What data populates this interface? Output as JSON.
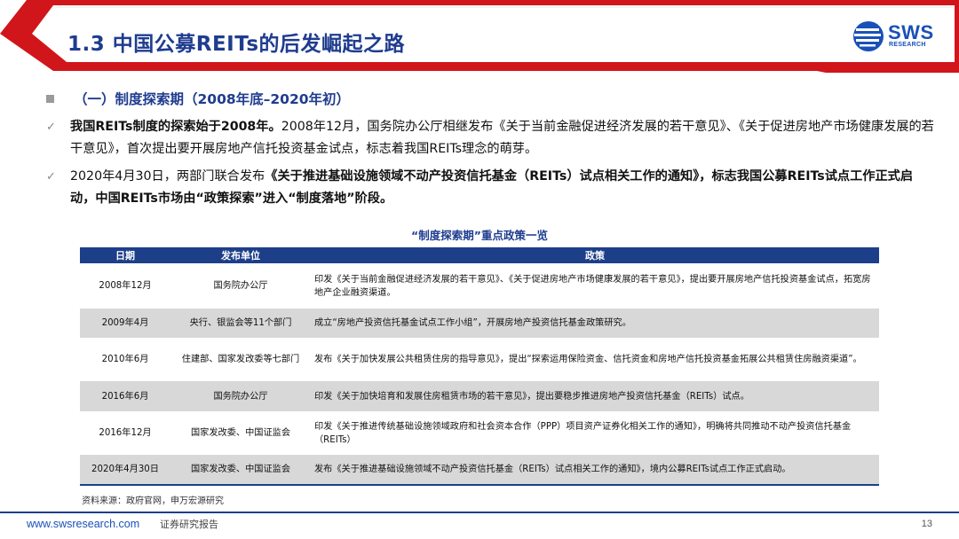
{
  "header": {
    "title": "1.3 中国公募REITs的后发崛起之路",
    "logo_text": "SWS",
    "logo_subtext": "RESEARCH"
  },
  "section": {
    "heading": "（一）制度探索期（2008年底–2020年初）"
  },
  "bullets": [
    {
      "bold": "我国REITs制度的探索始于2008年。",
      "text": "2008年12月，国务院办公厅相继发布《关于当前金融促进经济发展的若干意见》、《关于促进房地产市场健康发展的若干意见》，首次提出要开展房地产信托投资基金试点，标志着我国REITs理念的萌芽。"
    },
    {
      "text": "2020年4月30日，两部门联合发布",
      "bold": "《关于推进基础设施领域不动产投资信托基金（REITs）试点相关工作的通知》，标志我国公募REITs试点工作正式启动，中国REITs市场由“政策探索”进入“制度落地”阶段。"
    }
  ],
  "table": {
    "title": "“制度探索期”重点政策一览",
    "headers": [
      "日期",
      "发布单位",
      "政策"
    ],
    "rows": [
      {
        "date": "2008年12月",
        "issuer": "国务院办公厅",
        "policy": "印发《关于当前金融促进经济发展的若干意见》、《关于促进房地产市场健康发展的若干意见》，提出要开展房地产信托投资基金试点，拓宽房地产企业融资渠道。"
      },
      {
        "date": "2009年4月",
        "issuer": "央行、银监会等11个部门",
        "policy": "成立“房地产投资信托基金试点工作小组”，开展房地产投资信托基金政策研究。"
      },
      {
        "date": "2010年6月",
        "issuer": "住建部、国家发改委等七部门",
        "policy": "发布《关于加快发展公共租赁住房的指导意见》，提出“探索运用保险资金、信托资金和房地产信托投资基金拓展公共租赁住房融资渠道”。"
      },
      {
        "date": "2016年6月",
        "issuer": "国务院办公厅",
        "policy": "印发《关于加快培育和发展住房租赁市场的若干意见》，提出要稳步推进房地产投资信托基金（REITs）试点。"
      },
      {
        "date": "2016年12月",
        "issuer": "国家发改委、中国证监会",
        "policy": "印发《关于推进传统基础设施领域政府和社会资本合作（PPP）项目资产证券化相关工作的通知》，明确将共同推动不动产投资信托基金（REITs）"
      },
      {
        "date": "2020年4月30日",
        "issuer": "国家发改委、中国证监会",
        "policy": "发布《关于推进基础设施领域不动产投资信托基金（REITs）试点相关工作的通知》，境内公募REITs试点工作正式启动。"
      }
    ],
    "source": "资料来源：政府官网，申万宏源研究"
  },
  "footer": {
    "url": "www.swsresearch.com",
    "note": "证券研究报告",
    "page": "13"
  },
  "colors": {
    "red": "#d0161b",
    "navy": "#1d3f8a",
    "title_blue": "#1f3c8f",
    "row_gray": "#d8d8d8"
  }
}
